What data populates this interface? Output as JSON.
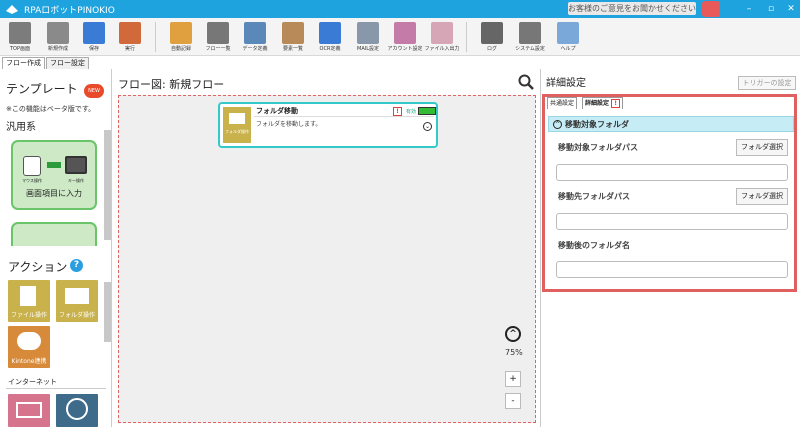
{
  "app": {
    "title": "RPAロボットPINOKIO",
    "feedback": "お客様のご意見をお聞かせください"
  },
  "toolbar": [
    {
      "label": "TOP画面",
      "icon": "home-icon",
      "color": "#7c7c7c"
    },
    {
      "label": "新規作成",
      "icon": "new-doc-icon",
      "color": "#8a8a8a"
    },
    {
      "label": "保存",
      "icon": "save-icon",
      "color": "#3a7bd5"
    },
    {
      "label": "実行",
      "icon": "run-icon",
      "color": "#d2693b"
    },
    {
      "label": "自動記録",
      "icon": "auto-record-icon",
      "color": "#e0a040"
    },
    {
      "label": "フロー一覧",
      "icon": "flow-list-icon",
      "color": "#777"
    },
    {
      "label": "データ定義",
      "icon": "database-icon",
      "color": "#5a88b8"
    },
    {
      "label": "要素一覧",
      "icon": "box-icon",
      "color": "#b88a5a"
    },
    {
      "label": "OCR定義",
      "icon": "ocr-icon",
      "color": "#3a7bd5"
    },
    {
      "label": "MAIL設定",
      "icon": "mail-icon",
      "color": "#8898aa"
    },
    {
      "label": "アカウント設定",
      "icon": "account-icon",
      "color": "#c47ba8"
    },
    {
      "label": "ファイル入出力",
      "icon": "file-io-icon",
      "color": "#d6a6b6"
    },
    {
      "label": "ログ",
      "icon": "log-icon",
      "color": "#666"
    },
    {
      "label": "システム設定",
      "icon": "gear-icon",
      "color": "#777"
    },
    {
      "label": "ヘルプ",
      "icon": "help-icon",
      "color": "#7aa8d8"
    }
  ],
  "tabs": [
    "フロー作成",
    "フロー設定"
  ],
  "left": {
    "template_title": "テンプレート",
    "new_badge": "NEW",
    "beta_note": "※この機能はベータ版です。",
    "category": "汎用系",
    "template_card": "画面項目に入力",
    "template_icons": [
      "マウス操作",
      "キー操作"
    ],
    "actions_title": "アクション",
    "help": "?",
    "action_tiles": [
      "ファイル操作",
      "フォルダ操作",
      "Kintone連携"
    ],
    "internet_label": "インターネット"
  },
  "flow": {
    "header": "フロー図:  新規フロー",
    "node": {
      "title": "フォルダ移動",
      "desc": "フォルダを移動します。",
      "icon_label": "フォルダ操作",
      "status": "有効",
      "warn": "!"
    },
    "zoom": "75%",
    "zoom_in": "+",
    "zoom_out": "-",
    "zoom_up": "^"
  },
  "detail": {
    "header": "詳細設定",
    "trigger": "トリガーの設定",
    "tabs": [
      "共通設定",
      "詳細設定"
    ],
    "section": "移動対象フォルダ",
    "fields": [
      {
        "label": "移動対象フォルダパス",
        "button": "フォルダ選択",
        "value": ""
      },
      {
        "label": "移動先フォルダパス",
        "button": "フォルダ選択",
        "value": ""
      },
      {
        "label": "移動後のフォルダ名",
        "value": ""
      }
    ]
  }
}
